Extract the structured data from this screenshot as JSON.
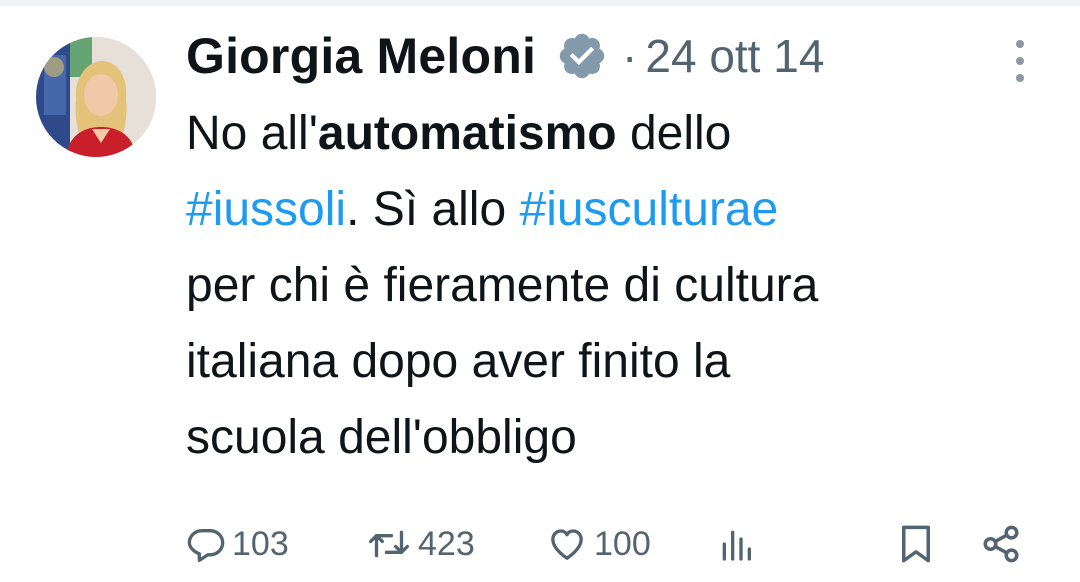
{
  "tweet": {
    "author_name": "Giorgia Meloni",
    "separator": "·",
    "timestamp": "24 ott 14",
    "text": {
      "line1_a": "No all'",
      "line1_bold": "automatismo",
      "line1_b": " dello",
      "hashtag_1": "#iussoli",
      "line2_mid": ". Sì allo ",
      "hashtag_2": "#iusculturae",
      "line3": "per chi è fieramente di cultura",
      "line4": "italiana dopo aver finito la",
      "line5": "scuola dell'obbligo"
    }
  },
  "actions": {
    "replies": "103",
    "reposts": "423",
    "likes": "100"
  },
  "icons": {
    "verified": "verified-badge-icon",
    "more": "more-vertical-icon",
    "reply": "reply-icon",
    "repost": "repost-icon",
    "like": "heart-icon",
    "views": "views-chart-icon",
    "bookmark": "bookmark-icon",
    "share": "share-icon"
  },
  "colors": {
    "hashtag": "#1d9bf0",
    "text": "#0f1419",
    "secondary": "#536471",
    "verified_badge": "#829aab"
  }
}
